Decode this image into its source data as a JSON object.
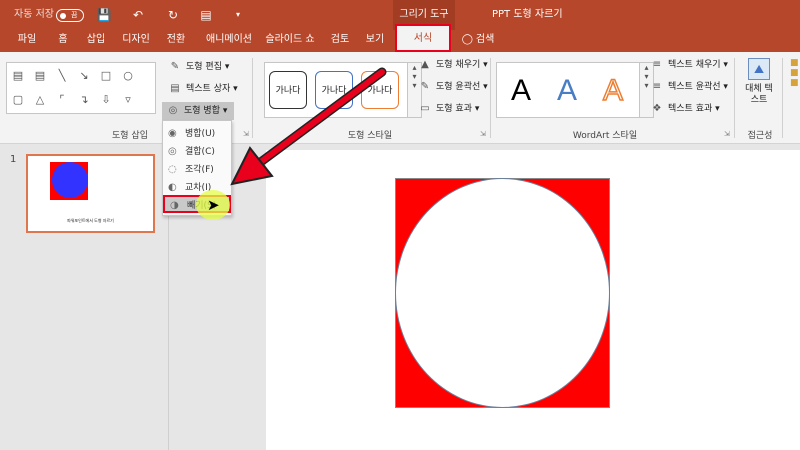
{
  "titlebar": {
    "autosave_label": "자동 저장",
    "autosave_state": "끔",
    "context_tool": "그리기 도구",
    "doc_title": "PPT 도형 자르기",
    "quick_access": [
      "save-icon",
      "undo-icon",
      "redo-icon",
      "present-icon",
      "customize-icon"
    ]
  },
  "tabs": [
    {
      "label": "파일"
    },
    {
      "label": "홈"
    },
    {
      "label": "삽입"
    },
    {
      "label": "디자인"
    },
    {
      "label": "전환"
    },
    {
      "label": "애니메이션"
    },
    {
      "label": "슬라이드 쇼"
    },
    {
      "label": "검토"
    },
    {
      "label": "보기"
    },
    {
      "label": "서식"
    }
  ],
  "search_label": "검색",
  "ribbon": {
    "insert_shapes_group": "도형 삽입",
    "shape_styles_group": "도형 스타일",
    "wordart_group": "WordArt 스타일",
    "accessibility_group": "접근성",
    "edit_shape": "도형 편집",
    "text_box": "텍스트 상자",
    "merge_shapes": "도형 병합",
    "shape_fill": "도형 채우기",
    "shape_outline": "도형 윤곽선",
    "shape_effects": "도형 효과",
    "text_fill": "텍스트 채우기",
    "text_outline": "텍스트 윤곽선",
    "text_effects": "텍스트 효과",
    "alt_text": "대체 텍스트",
    "style_samples": [
      "가나다",
      "가나다",
      "가나다"
    ],
    "wordart_letters": [
      "A",
      "A",
      "A"
    ]
  },
  "merge_menu": [
    {
      "label": "병합(U)"
    },
    {
      "label": "결합(C)"
    },
    {
      "label": "조각(F)"
    },
    {
      "label": "교차(I)"
    },
    {
      "label": "빼기(S)"
    }
  ],
  "thumbnails": [
    {
      "number": "1",
      "caption": "파워포인트에서 도형 자르기"
    }
  ],
  "colors": {
    "accent": "#b7472a",
    "highlight_box": "#e8001c",
    "square_fill": "#ff0000",
    "thumb_circle": "#3333ff"
  }
}
